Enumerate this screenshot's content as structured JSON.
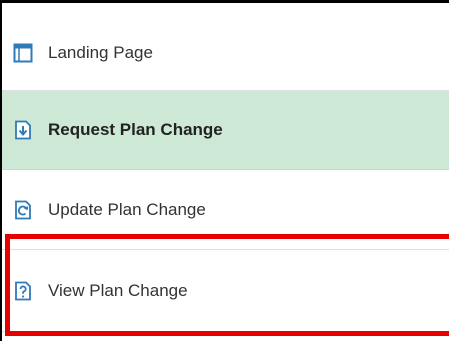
{
  "menu": {
    "items": [
      {
        "label": "Landing Page",
        "icon": "landing-page-icon",
        "active": false
      },
      {
        "label": "Request Plan Change",
        "icon": "request-document-icon",
        "active": true
      },
      {
        "label": "Update Plan Change",
        "icon": "update-document-icon",
        "active": false
      },
      {
        "label": "View Plan Change",
        "icon": "view-document-icon",
        "active": false
      }
    ]
  },
  "colors": {
    "active_background": "#cde9d6",
    "icon_blue": "#2f7ab9",
    "highlight_red": "#e60000"
  }
}
